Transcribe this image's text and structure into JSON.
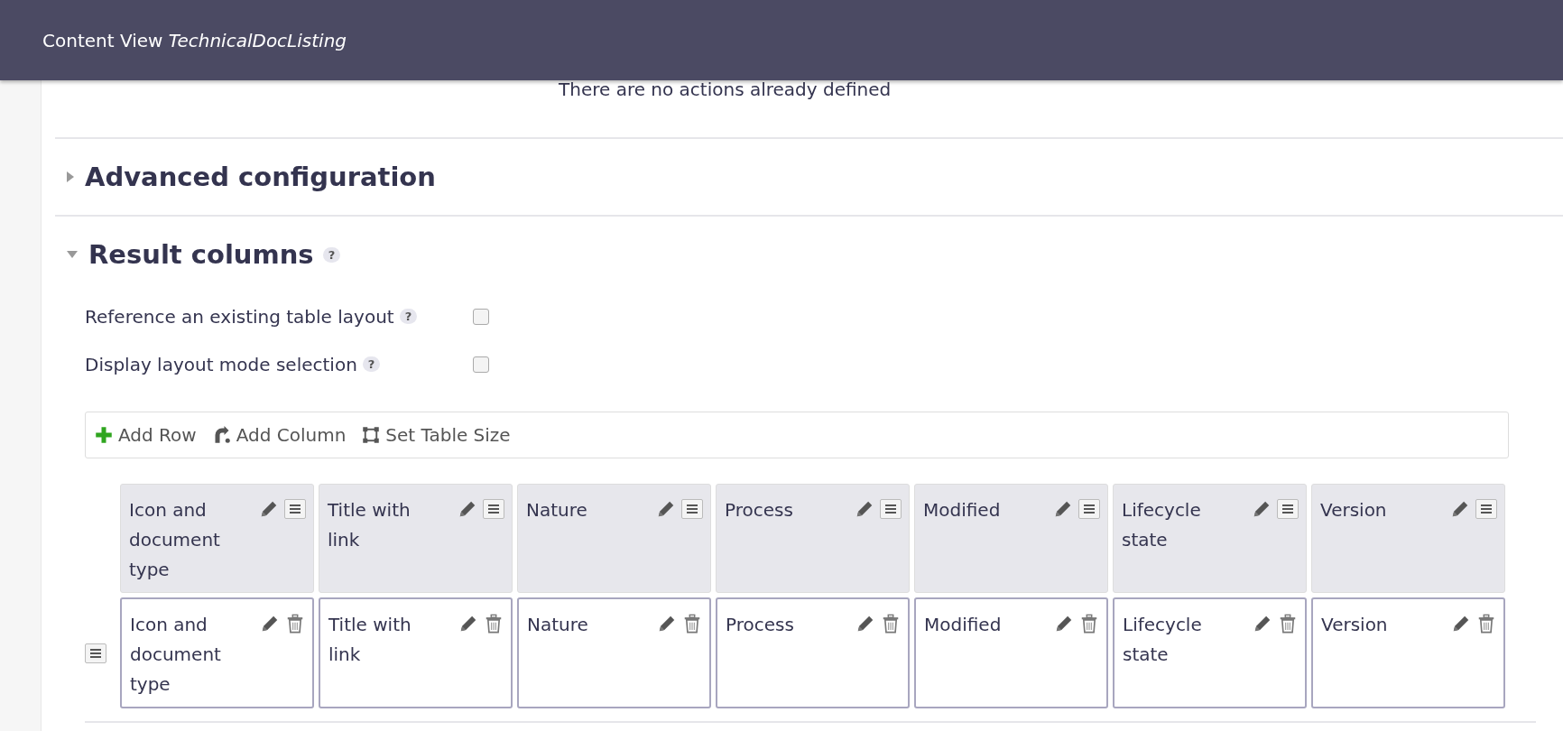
{
  "header": {
    "title": "Content View",
    "subtitle": "TechnicalDocListing"
  },
  "notice": "There are no actions already defined",
  "sections": [
    {
      "title": "Advanced configuration",
      "expanded": false
    },
    {
      "title": "Result columns",
      "expanded": true,
      "help": "?"
    }
  ],
  "options": [
    {
      "label": "Reference an existing table layout",
      "help": "?",
      "checked": false
    },
    {
      "label": "Display layout mode selection",
      "help": "?",
      "checked": false
    }
  ],
  "toolbar": [
    {
      "kind": "add-row",
      "label": "Add Row"
    },
    {
      "kind": "add-column",
      "label": "Add Column"
    },
    {
      "kind": "table-size",
      "label": "Set Table Size"
    }
  ],
  "table": {
    "columns": [
      "Icon and document type",
      "Title with link",
      "Nature",
      "Process",
      "Modified",
      "Lifecycle state",
      "Version"
    ],
    "rows": [
      [
        "Icon and document type",
        "Title with link",
        "Nature",
        "Process",
        "Modified",
        "Lifecycle state",
        "Version"
      ]
    ]
  }
}
